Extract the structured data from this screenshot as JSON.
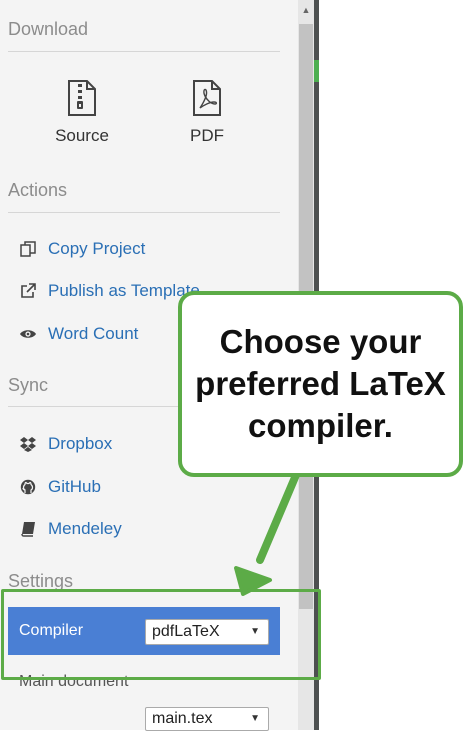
{
  "download": {
    "title": "Download",
    "items": [
      {
        "label": "Source",
        "icon": "zip-file-icon"
      },
      {
        "label": "PDF",
        "icon": "pdf-file-icon"
      }
    ]
  },
  "actions": {
    "title": "Actions",
    "items": [
      {
        "label": "Copy Project",
        "icon": "copy-icon"
      },
      {
        "label": "Publish as Template",
        "icon": "external-link-icon"
      },
      {
        "label": "Word Count",
        "icon": "eye-icon"
      }
    ]
  },
  "sync": {
    "title": "Sync",
    "items": [
      {
        "label": "Dropbox",
        "icon": "dropbox-icon"
      },
      {
        "label": "GitHub",
        "icon": "github-icon"
      },
      {
        "label": "Mendeley",
        "icon": "book-icon"
      }
    ]
  },
  "settings": {
    "title": "Settings",
    "compiler_label": "Compiler",
    "compiler_value": "pdfLaTeX",
    "main_document_label": "Main document",
    "main_document_value": "main.tex"
  },
  "callout": {
    "line1": "Choose your",
    "line2": "preferred LaTeX",
    "line3": "compiler."
  },
  "colors": {
    "accent_green": "#5cab47",
    "link_blue": "#2a6fb5",
    "compiler_row_bg": "#4a7fd4"
  }
}
